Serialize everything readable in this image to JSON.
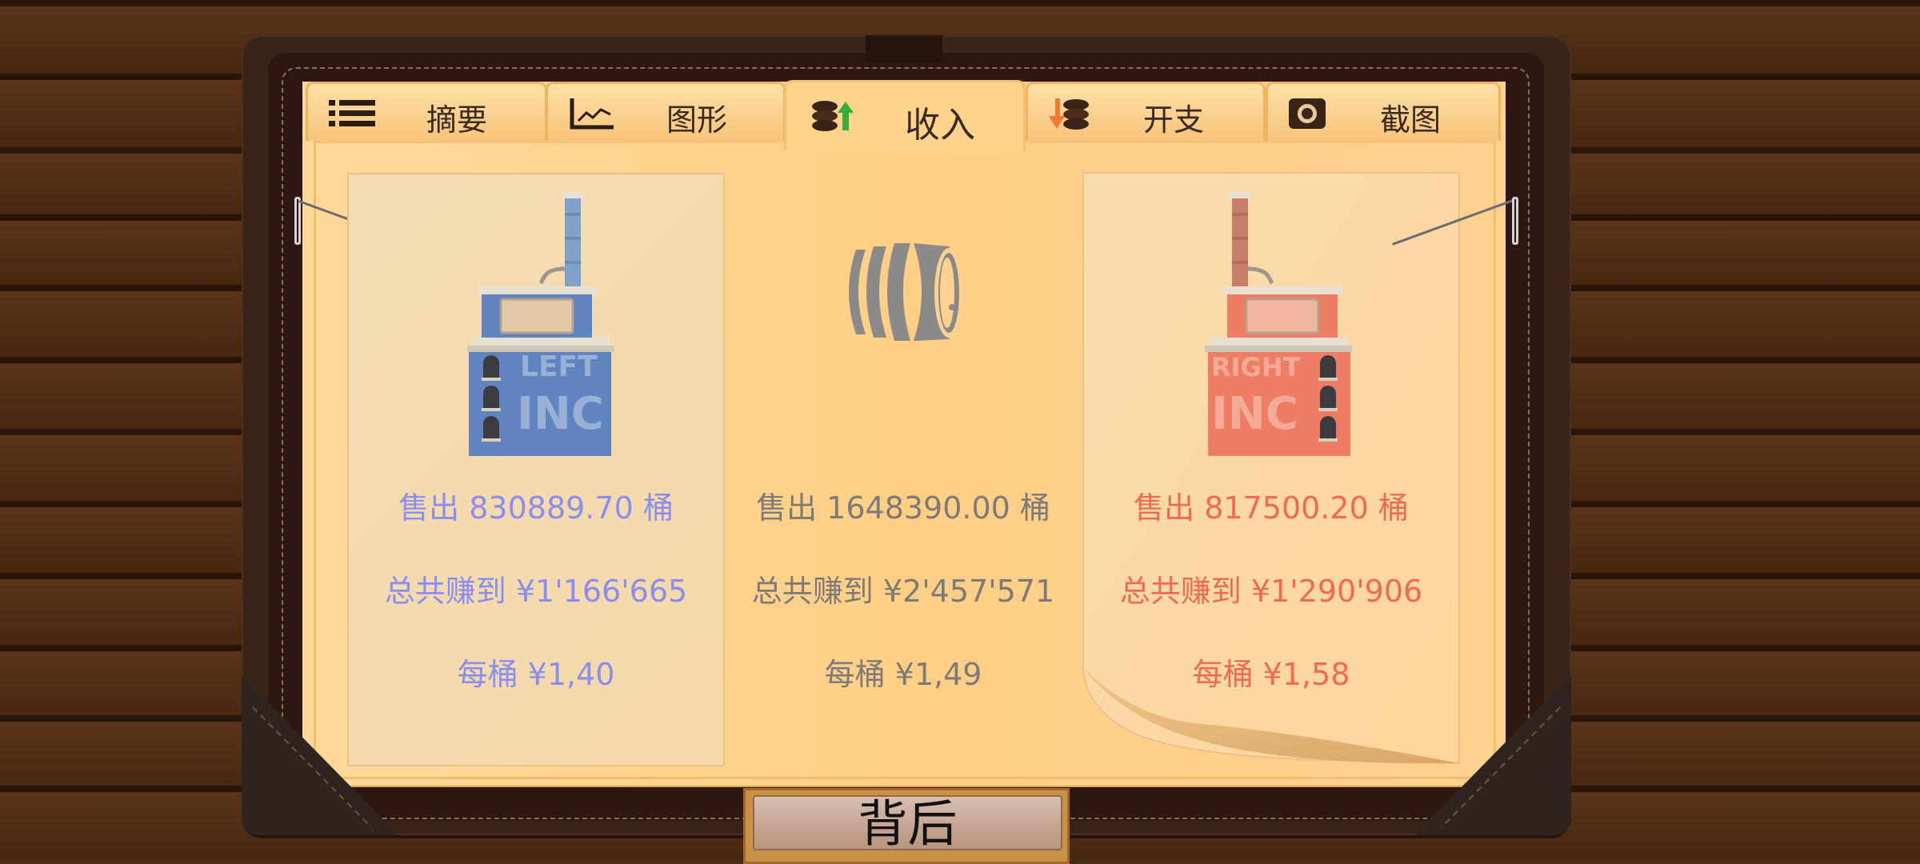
{
  "tabs": [
    {
      "label": "摘要",
      "icon": "list-icon"
    },
    {
      "label": "图形",
      "icon": "line-chart-icon"
    },
    {
      "label": "收入",
      "icon": "coins-income-icon",
      "active": true
    },
    {
      "label": "开支",
      "icon": "coins-expense-icon"
    },
    {
      "label": "截图",
      "icon": "camera-icon"
    }
  ],
  "left": {
    "name": "LEFT INC",
    "sold": "售出 830889.70 桶",
    "earned": "总共赚到 ¥1'166'665",
    "per_barrel": "每桶 ¥1,40",
    "color": "#8a8ef0"
  },
  "total": {
    "sold": "售出 1648390.00 桶",
    "earned": "总共赚到 ¥2'457'571",
    "per_barrel": "每桶 ¥1,49",
    "color": "#7d7a78",
    "icon": "barrel-icon"
  },
  "right": {
    "name": "RIGHT INC",
    "sold": "售出 817500.20 桶",
    "earned": "总共赚到 ¥1'290'906",
    "per_barrel": "每桶 ¥1,58",
    "color": "#f06a52"
  },
  "back_button": "背后"
}
